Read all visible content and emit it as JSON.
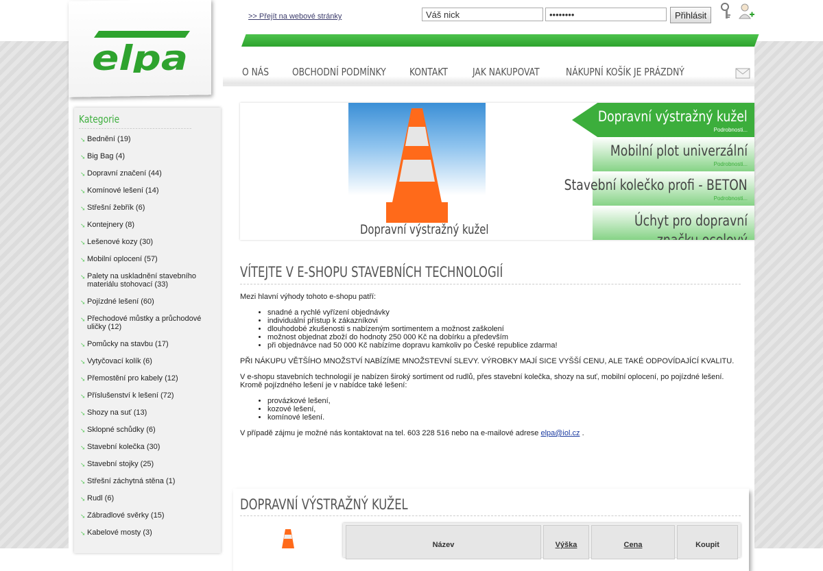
{
  "header": {
    "goto_link": ">> Přejít na webové stránky",
    "login_nick": "Váš nick",
    "login_password": "••••••••",
    "login_button": "Přihlásit"
  },
  "nav": {
    "items": [
      "O nás",
      "Obchodní podmínky",
      "Kontakt",
      "Jak nakupovat",
      "Nákupní košík je prázdný"
    ]
  },
  "sidebar": {
    "title": "Kategorie",
    "items": [
      "Bednění (19)",
      "Big Bag (4)",
      "Dopravní značení (44)",
      "Komínové lešení (14)",
      "Střešní žebřík (6)",
      "Kontejnery (8)",
      "Lešenové kozy (30)",
      "Mobilní oplocení (57)",
      "Palety na uskladnění stavebního materiálu stohovací (33)",
      "Pojízdné lešení (60)",
      "Přechodové můstky a průchodové uličky (12)",
      "Pomůcky na stavbu (17)",
      "Vytyčovací kolík (6)",
      "Přemostění pro kabely (12)",
      "Příslušenství k lešení (72)",
      "Shozy na suť (13)",
      "Sklopné schůdky (6)",
      "Stavební kolečka (30)",
      "Stavební stojky (25)",
      "Střešní záchytná stěna (1)",
      "Rudl (6)",
      "Zábradlové svěrky (15)",
      "Kabelové mosty (3)"
    ]
  },
  "slider": {
    "caption": "Dopravní výstražný kužel",
    "tabs": [
      {
        "title": "Dopravní výstražný kužel",
        "detail": "Podrobnosti..."
      },
      {
        "title": "Mobilní plot univerzální",
        "detail": "Podrobnosti..."
      },
      {
        "title": "Stavební kolečko profi - BETON",
        "detail": "Podrobnosti..."
      },
      {
        "title": "Úchyt pro dopravní značku ocelový",
        "detail": ""
      }
    ]
  },
  "welcome": {
    "title": "Vítejte v e-shopu stavebních technologií",
    "intro": "Mezi hlavní výhody tohoto e-shopu patří:",
    "advantages": [
      "snadné a rychlé vyřízení objednávky",
      "individuální přístup k zákazníkovi",
      "dlouhodobé zkušenosti s nabízeným sortimentem a možnost zaškolení",
      "možnost objednat zboží do hodnoty 250 000 Kč na dobírku a především",
      "při objednávce nad 50 000 Kč nabízíme dopravu kamkoliv po České republice zdarma!"
    ],
    "discount": "PŘI NÁKUPU VĚTŠÍHO MNOŽSTVÍ NABÍZÍME MNOŽSTEVNÍ SLEVY. VÝROBKY MAJÍ SICE VYŠŠÍ CENU, ALE TAKÉ ODPOVÍDAJÍCÍ KVALITU.",
    "para1": "V e-shopu stavebních technologií je nabízen široký sortiment od rudlů, přes stavební kolečka, shozy na suť, mobilní oplocení, po pojízdné lešení. Kromě pojízdného lešení je v nabídce také lešení:",
    "scaffolds": [
      "provázkové lešení,",
      "kozové lešení,",
      "komínové lešení."
    ],
    "contact_text": "V případě zájmu je možné nás kontaktovat na tel. 603 228 516 nebo na e-mailové adrese",
    "contact_email": "elpa@iol.cz",
    "contact_end": "."
  },
  "product": {
    "title": "Dopravní výstražný kužel",
    "columns": [
      "Název",
      "Výška",
      "Cena",
      "Koupit"
    ]
  },
  "colors": {
    "brand_green": "#2ea32e",
    "tab_active": "#3cae3c",
    "tab_inactive": "#86d386"
  }
}
